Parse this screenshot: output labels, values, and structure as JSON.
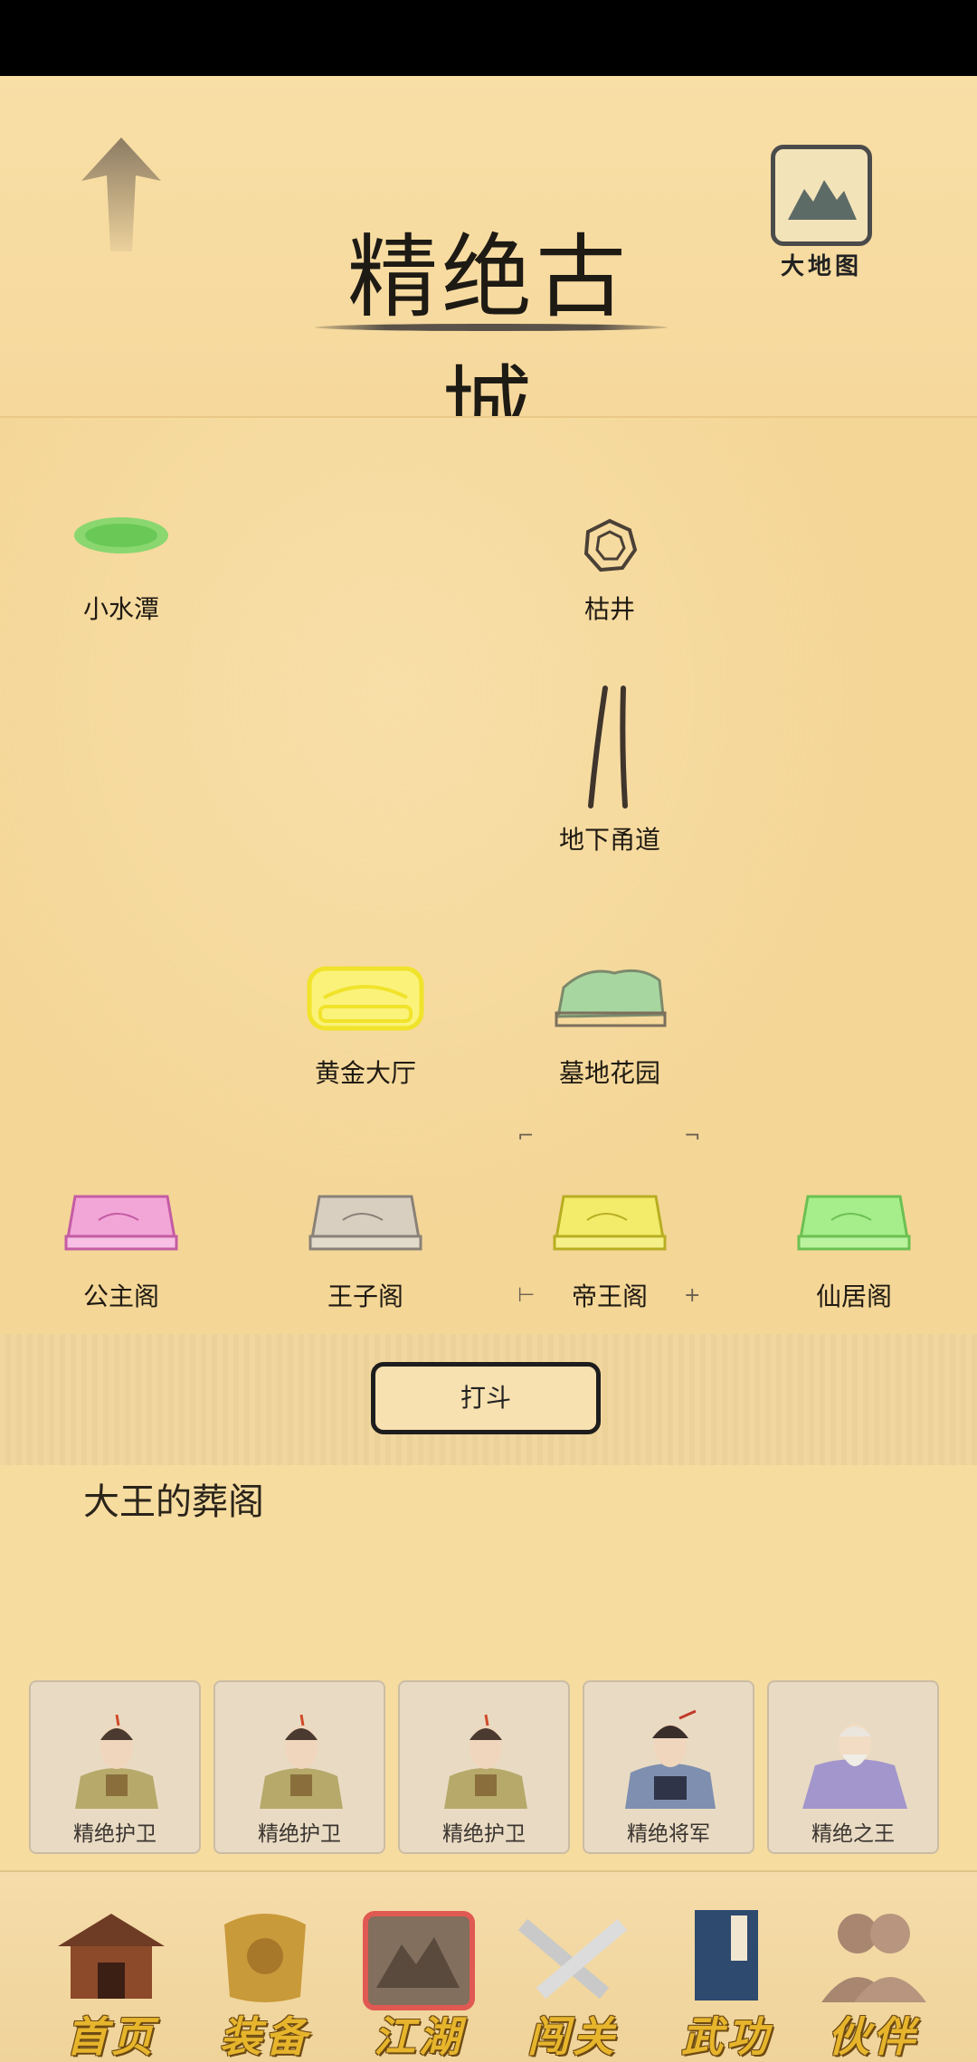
{
  "header": {
    "title": "精绝古城",
    "map_button_label": "大地图"
  },
  "locations": [
    {
      "name": "小水潭",
      "icon": "pond-icon"
    },
    {
      "name": "枯井",
      "icon": "well-icon"
    },
    {
      "name": "地下甬道",
      "icon": "tunnel-icon"
    },
    {
      "name": "黄金大厅",
      "icon": "gold-hall-icon"
    },
    {
      "name": "墓地花园",
      "icon": "tomb-garden-icon"
    },
    {
      "name": "公主阁",
      "icon": "pink-chest-icon"
    },
    {
      "name": "王子阁",
      "icon": "gray-chest-icon"
    },
    {
      "name": "帝王阁",
      "icon": "yellow-chest-icon"
    },
    {
      "name": "仙居阁",
      "icon": "green-chest-icon"
    }
  ],
  "fight_button": "打斗",
  "scene_title": "大王的葬阁",
  "enemies": [
    {
      "name": "精绝护卫"
    },
    {
      "name": "精绝护卫"
    },
    {
      "name": "精绝护卫"
    },
    {
      "name": "精绝将军"
    },
    {
      "name": "精绝之王"
    }
  ],
  "bottom_nav": [
    {
      "label": "首页",
      "icon": "house-icon"
    },
    {
      "label": "装备",
      "icon": "armor-icon"
    },
    {
      "label": "江湖",
      "icon": "scroll-map-icon",
      "active": true
    },
    {
      "label": "闯关",
      "icon": "crossed-swords-icon"
    },
    {
      "label": "武功",
      "icon": "book-icon"
    },
    {
      "label": "伙伴",
      "icon": "partners-icon"
    }
  ],
  "colors": {
    "background": "#f7dca0",
    "nav_label": "#e7b52c",
    "active_glow": "#e0534f"
  }
}
